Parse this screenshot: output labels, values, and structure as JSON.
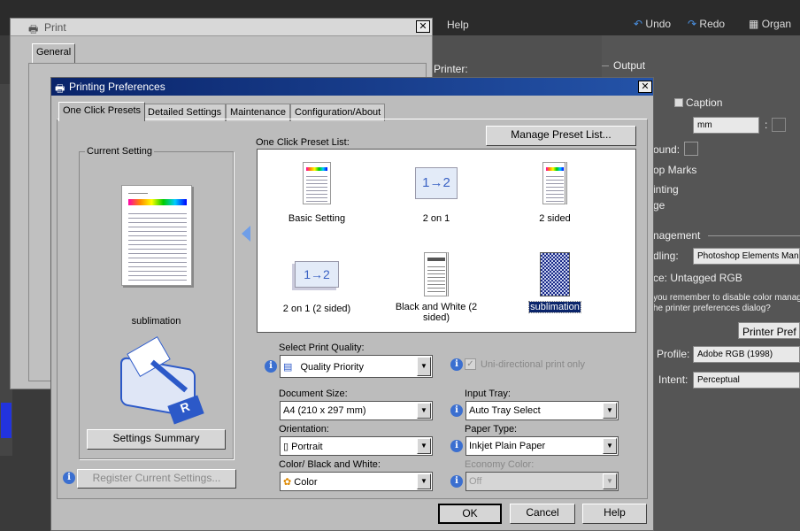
{
  "bg": {
    "menu": {
      "help": "Help",
      "undo": "Undo",
      "redo": "Redo",
      "organizer": "Organ"
    },
    "right": {
      "printer": "Printer:",
      "output": "Output",
      "caption": "Caption",
      "unit": "mm",
      "background": "ound:",
      "crop": "op Marks",
      "printing": "inting",
      "image": "ge",
      "color_mgmt": "nagement",
      "handling_lbl": "dling:",
      "handling": "Photoshop Elements Mana",
      "space": "ce:  Untagged RGB",
      "note1": "you remember to disable color manag",
      "note2": "he printer preferences dialog?",
      "printer_pref": "Printer Pref",
      "profile_lbl": "Profile:",
      "profile": "Adobe RGB (1998)",
      "intent_lbl": "Intent:",
      "intent": "Perceptual"
    }
  },
  "print_dialog": {
    "title": "Print",
    "tab": "General"
  },
  "prefs": {
    "title": "Printing Preferences",
    "tabs": [
      "One Click Presets",
      "Detailed Settings",
      "Maintenance",
      "Configuration/About"
    ],
    "current_setting": "Current Setting",
    "current_name": "sublimation",
    "settings_summary": "Settings Summary",
    "preset_list_label": "One Click Preset List:",
    "manage": "Manage Preset List...",
    "presets": [
      "Basic Setting",
      "2 on 1",
      "2 sided",
      "2 on 1 (2 sided)",
      "Black and White (2 sided)",
      "sublimation"
    ],
    "quality_lbl": "Select Print Quality:",
    "quality": "Quality Priority",
    "unidirectional": "Uni-directional print only",
    "docsize_lbl": "Document Size:",
    "docsize": "A4 (210 x 297 mm)",
    "tray_lbl": "Input Tray:",
    "tray": "Auto Tray Select",
    "orient_lbl": "Orientation:",
    "orient": "Portrait",
    "paper_lbl": "Paper Type:",
    "paper": "Inkjet Plain Paper",
    "color_lbl": "Color/ Black and White:",
    "color": "Color",
    "economy_lbl": "Economy Color:",
    "economy": "Off",
    "register": "Register Current Settings...",
    "ok": "OK",
    "cancel": "Cancel",
    "help": "Help"
  }
}
